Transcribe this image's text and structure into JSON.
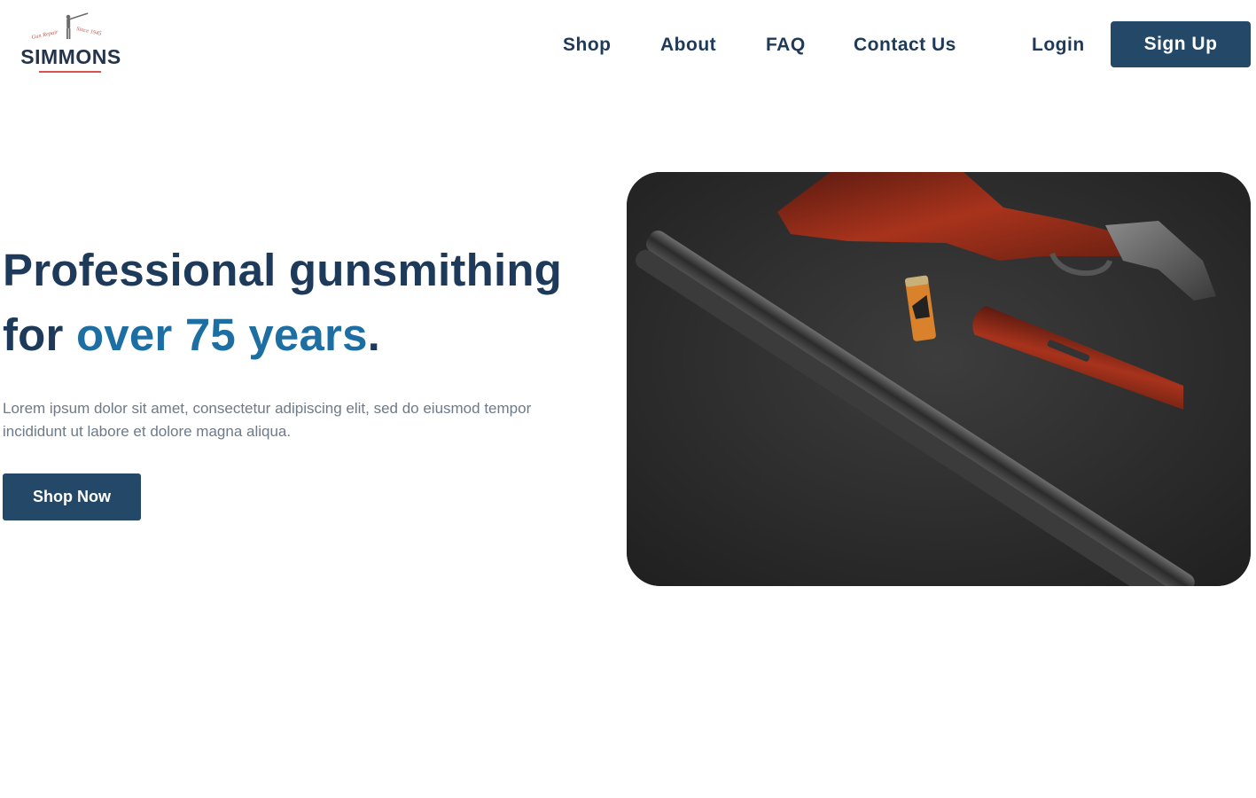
{
  "brand": {
    "name": "SIMMONS",
    "tagline_left": "Gun Repair",
    "tagline_right": "Since 1945",
    "logo_icon": "hunter-with-rifle-icon",
    "underline_color": "#d9534f"
  },
  "nav": {
    "items": [
      {
        "label": "Shop"
      },
      {
        "label": "About"
      },
      {
        "label": "FAQ"
      },
      {
        "label": "Contact Us"
      }
    ],
    "login_label": "Login",
    "signup_label": "Sign Up"
  },
  "hero": {
    "title_part1": "Professional gunsmithing for ",
    "title_accent": "over 75 years",
    "title_end": ".",
    "body": "Lorem ipsum dolor sit amet, consectetur adipiscing elit, sed do eiusmod tempor incididunt ut labore et dolore magna aliqua.",
    "cta_label": "Shop Now",
    "image_subject": "disassembled-double-barrel-shotgun-photo"
  },
  "colors": {
    "primary": "#244867",
    "heading": "#1e3a5a",
    "accent": "#1d6fa3",
    "body_text": "#6d7a8a"
  }
}
